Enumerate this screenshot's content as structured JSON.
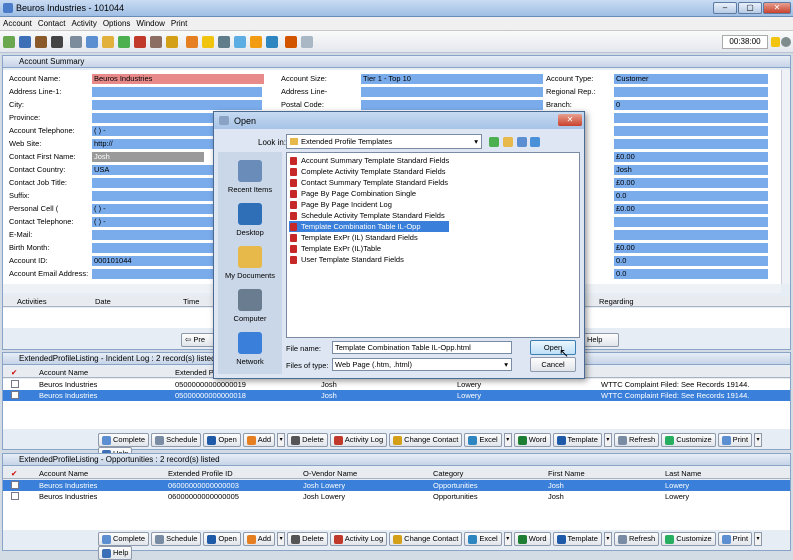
{
  "window": {
    "title": "Beuros Industries - 101044",
    "min": "–",
    "max": "▢",
    "close": "✕"
  },
  "menu": [
    "Account",
    "Contact",
    "Activity",
    "Options",
    "Window",
    "Print"
  ],
  "toolbar": {
    "clock": "00:38:00"
  },
  "summary": {
    "title": "Account Summary",
    "left": [
      {
        "label": "Account Name:",
        "value": "Beuros Industries"
      },
      {
        "label": "Address Line-1:",
        "value": ""
      },
      {
        "label": "City:",
        "value": ""
      },
      {
        "label": "Province:",
        "value": ""
      },
      {
        "label": "Account Telephone:",
        "value": "( )  -"
      },
      {
        "label": "Web Site:",
        "value": "http://"
      },
      {
        "label": "Contact First Name:",
        "value": "Josh"
      },
      {
        "label": "Contact Country:",
        "value": "USA"
      },
      {
        "label": "Contact Job Title:",
        "value": ""
      },
      {
        "label": "Suffix:",
        "value": ""
      },
      {
        "label": "Personal Cell (",
        "value": "( )  -"
      },
      {
        "label": "Contact Telephone:",
        "value": "( )  -"
      },
      {
        "label": "E-Mail:",
        "value": ""
      },
      {
        "label": "Birth Month:",
        "value": ""
      },
      {
        "label": "Account ID:",
        "value": "000101044"
      },
      {
        "label": "Account Email Address:",
        "value": ""
      }
    ],
    "mid": [
      {
        "label": "Account Size:",
        "value": "Tier 1 - Top 10"
      },
      {
        "label": "Address Line-",
        "value": ""
      },
      {
        "label": "Postal Code:",
        "value": ""
      }
    ],
    "right": [
      {
        "label": "Account Type:",
        "value": "Customer"
      },
      {
        "label": "Regional Rep.:",
        "value": ""
      },
      {
        "label": "Branch:",
        "value": "0"
      },
      {
        "label": "",
        "value": ""
      },
      {
        "label": "",
        "value": ""
      },
      {
        "label": "",
        "value": ""
      },
      {
        "label": "",
        "value": "£0.00"
      },
      {
        "label": "Name:",
        "value": "Josh"
      },
      {
        "label": "",
        "value": "£0.00"
      },
      {
        "label": "ent D...",
        "value": "0.0"
      },
      {
        "label": "ent:",
        "value": "£0.00"
      },
      {
        "label": "",
        "value": ""
      },
      {
        "label": "",
        "value": ""
      },
      {
        "label": "):",
        "value": "£0.00"
      },
      {
        "label": "atio:",
        "value": "0.0"
      },
      {
        "label": "atio:",
        "value": "0.0"
      }
    ],
    "activity_cols": [
      "Activities",
      "Date",
      "Time",
      "Regarding"
    ],
    "prev": "Pre",
    "help": "Help"
  },
  "dialog": {
    "title": "Open",
    "look_in_label": "Look in:",
    "look_in": "Extended Profile Templates",
    "places": [
      "Recent Items",
      "Desktop",
      "My Documents",
      "Computer",
      "Network"
    ],
    "files": [
      "Account Summary Template Standard Fields",
      "Complete Activity Template Standard Fields",
      "Contact Summary Template Standard Fields",
      "Page By Page Combination Single",
      "Page By Page Incident Log",
      "Schedule Activity Template Standard Fields",
      "Template Combination Table IL-Opp",
      "Template ExPr (IL) Standard Fields",
      "Template ExPr (IL)Table",
      "User Template Standard Fields"
    ],
    "selected_index": 6,
    "file_name_label": "File name:",
    "file_name": "Template Combination Table IL-Opp.html",
    "file_type_label": "Files of type:",
    "file_type": "Web Page (.htm, .html)",
    "open": "Open",
    "cancel": "Cancel"
  },
  "incident": {
    "title": "ExtendedProfileListing - Incident Log : 2 record(s) listed",
    "cols": [
      "Account Name",
      "Extended Pro"
    ],
    "rows": [
      {
        "name": "Beuros Industries",
        "id": "05000000000000019",
        "contact": "Josh",
        "last": "Lowery",
        "regarding": "WTTC Complaint Filed: See Records 19144."
      },
      {
        "name": "Beuros Industries",
        "id": "05000000000000018",
        "contact": "Josh",
        "last": "Lowery",
        "regarding": "WTTC Complaint Filed: See Records 19144."
      }
    ]
  },
  "opps": {
    "title": "ExtendedProfileListing - Opportunities : 2 record(s) listed",
    "cols": [
      "Account Name",
      "Extended Profile ID",
      "O-Vendor Name",
      "Category",
      "First Name",
      "Last Name"
    ],
    "rows": [
      {
        "name": "Beuros Industries",
        "id": "06000000000000003",
        "vendor": "Josh Lowery",
        "cat": "Opportunities",
        "first": "Josh",
        "last": "Lowery"
      },
      {
        "name": "Beuros Industries",
        "id": "06000000000000005",
        "vendor": "Josh Lowery",
        "cat": "Opportunities",
        "first": "Josh",
        "last": "Lowery"
      }
    ]
  },
  "buttons": [
    "Complete",
    "Schedule",
    "Open",
    "Add",
    "Delete",
    "Activity Log",
    "Change Contact",
    "Excel",
    "Word",
    "Template",
    "Refresh",
    "Customize",
    "Print",
    "Help"
  ]
}
